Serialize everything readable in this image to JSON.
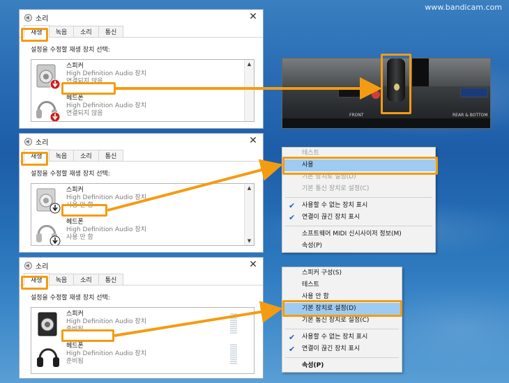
{
  "watermark": "www.bandicam.com",
  "dialogs": [
    {
      "title": "소리",
      "tabs": [
        "재생",
        "녹음",
        "소리",
        "통신"
      ],
      "instruction": "설정을 수정할 재생 장치 선택:",
      "devices": [
        {
          "name": "스피커",
          "line1": "High Definition Audio 장치",
          "line2": "연결되지 않음"
        },
        {
          "name": "헤드폰",
          "line1": "High Definition Audio 장치",
          "line2": "연결되지 않음"
        }
      ]
    },
    {
      "title": "소리",
      "tabs": [
        "재생",
        "녹음",
        "소리",
        "통신"
      ],
      "instruction": "설정을 수정할 재생 장치 선택:",
      "devices": [
        {
          "name": "스피커",
          "line1": "High Definition Audio 장치",
          "line2": "사용 안 함"
        },
        {
          "name": "헤드폰",
          "line1": "High Definition Audio 장치",
          "line2": "사용 안 함"
        }
      ]
    },
    {
      "title": "소리",
      "tabs": [
        "재생",
        "녹음",
        "소리",
        "통신"
      ],
      "instruction": "설정을 수정할 재생 장치 선택:",
      "devices": [
        {
          "name": "스피커",
          "line1": "High Definition Audio 장치",
          "line2": "준비됨"
        },
        {
          "name": "헤드폰",
          "line1": "High Definition Audio 장치",
          "line2": "준비됨"
        }
      ]
    }
  ],
  "photo": {
    "labels": [
      "FRONT",
      "REAR & BOTTOM"
    ]
  },
  "menu1": {
    "items": [
      "테스트",
      "사용",
      "기본 장치로 설정(D)",
      "기본 통신 장치로 설정(C)",
      "사용할 수 없는 장치 표시",
      "연결이 끊긴 장치 표시",
      "소프트웨어 MIDI 신시사이저 정보(M)",
      "속성(P)"
    ]
  },
  "menu2": {
    "items": [
      "스피커 구성(S)",
      "테스트",
      "사용 안 함",
      "기본 장치로 설정(D)",
      "기본 통신 장치로 설정(C)",
      "사용할 수 없는 장치 표시",
      "연결이 끊긴 장치 표시",
      "속성(P)"
    ]
  },
  "colors": {
    "highlight": "#f39c12",
    "menu_selected": "#9fcbf0",
    "check": "#1d62c2",
    "status_red": "#cc1f1f"
  },
  "icons": [
    "sound-icon",
    "close-icon",
    "speaker-icon",
    "headphones-icon",
    "disconnected-badge-icon",
    "disabled-badge-icon",
    "checkmark-icon",
    "scroll-up-icon",
    "scroll-down-icon"
  ]
}
